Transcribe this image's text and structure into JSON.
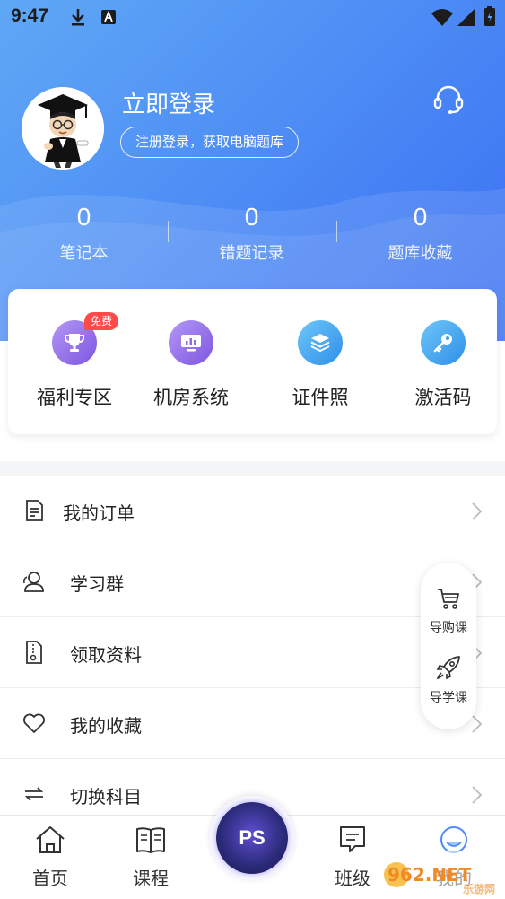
{
  "status_bar": {
    "time": "9:47"
  },
  "profile": {
    "login_title": "立即登录",
    "login_subtitle": "注册登录，获取电脑题库"
  },
  "stats": [
    {
      "value": "0",
      "label": "笔记本"
    },
    {
      "value": "0",
      "label": "错题记录"
    },
    {
      "value": "0",
      "label": "题库收藏"
    }
  ],
  "features": [
    {
      "label": "福利专区",
      "icon": "trophy-icon",
      "color": "#8f6be8",
      "badge": "免费"
    },
    {
      "label": "机房系统",
      "icon": "monitor-icon",
      "color": "#8f6be8"
    },
    {
      "label": "证件照",
      "icon": "layers-icon",
      "color": "#3ea3f2"
    },
    {
      "label": "激活码",
      "icon": "key-icon",
      "color": "#3ea3f2"
    }
  ],
  "menu": [
    {
      "label": "我的订单",
      "icon": "document-icon"
    },
    {
      "label": "学习群",
      "icon": "group-icon"
    },
    {
      "label": "领取资料",
      "icon": "zip-file-icon"
    },
    {
      "label": "我的收藏",
      "icon": "heart-icon"
    },
    {
      "label": "切换科目",
      "icon": "switch-icon"
    }
  ],
  "float_panel": [
    {
      "label": "导购课",
      "icon": "cart-icon"
    },
    {
      "label": "导学课",
      "icon": "rocket-icon"
    }
  ],
  "bottom_nav": [
    {
      "label": "首页",
      "icon": "home-icon"
    },
    {
      "label": "课程",
      "icon": "book-icon"
    },
    {
      "label": "PS",
      "icon": "ps-app-icon"
    },
    {
      "label": "班级",
      "icon": "message-icon"
    },
    {
      "label": "我的",
      "icon": "profile-icon"
    }
  ],
  "watermark": {
    "text": "962.NET",
    "subtext": "乐游网"
  },
  "colors": {
    "accent": "#4d8cf5",
    "purple": "#8f6be8",
    "badge_red": "#ff4a4a"
  }
}
